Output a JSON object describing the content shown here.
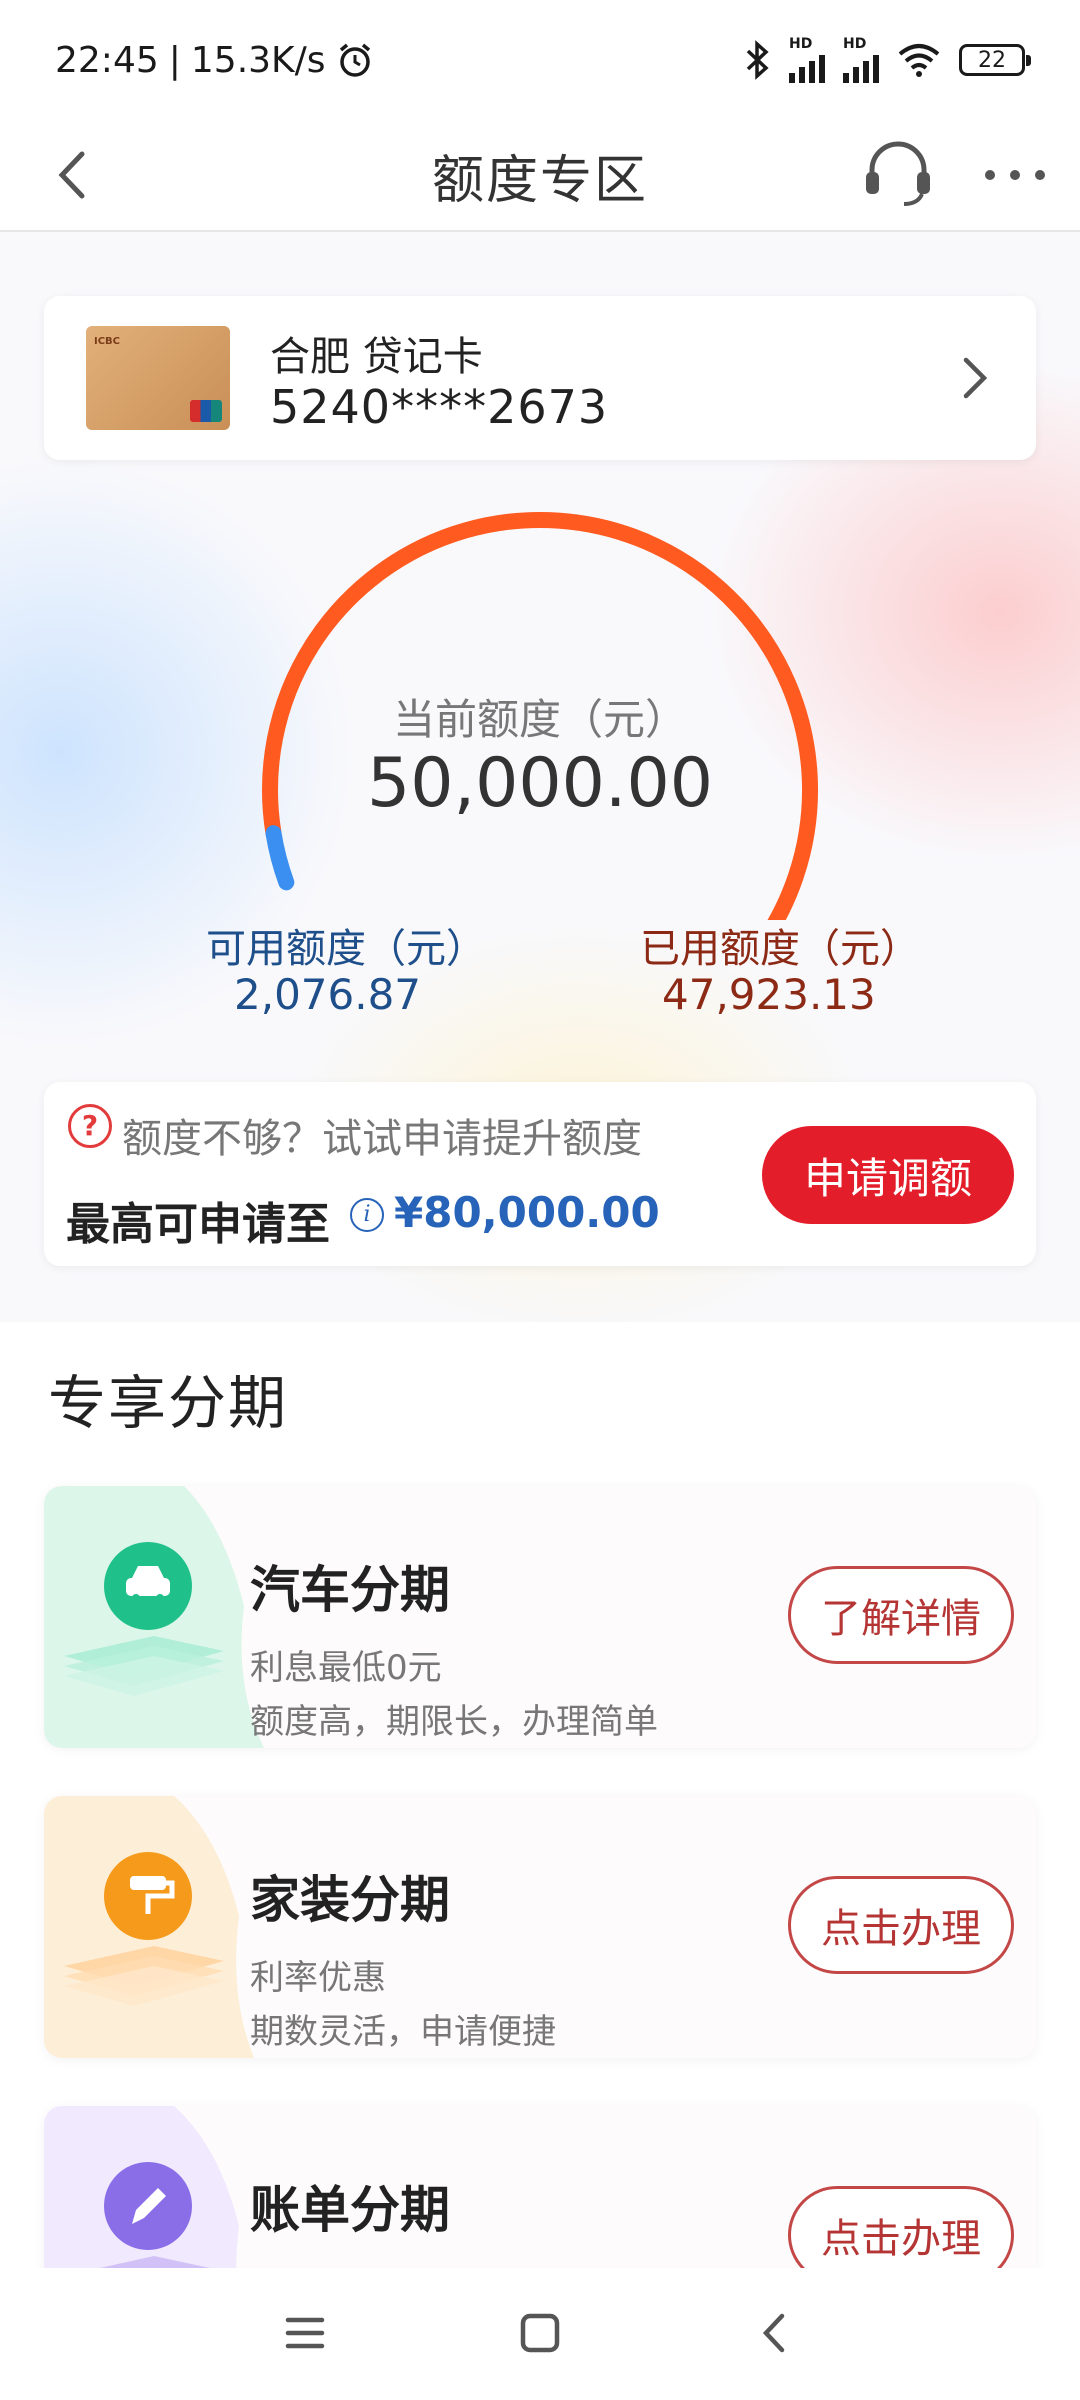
{
  "status_bar": {
    "time": "22:45",
    "speed": "15.3K/s",
    "battery": "22",
    "hd1": "HD",
    "hd2": "HD"
  },
  "header": {
    "title": "额度专区",
    "back_icon": "back-chevron-icon",
    "service_icon": "headset-icon",
    "more_icon": "more-dots-icon"
  },
  "card": {
    "name": "合肥 贷记卡",
    "number": "5240****2673"
  },
  "limit": {
    "current_label": "当前额度（元）",
    "current_value": "50,000.00",
    "available_label": "可用额度（元）",
    "available_value": "2,076.87",
    "used_label": "已用额度（元）",
    "used_value": "47,923.13",
    "available_fraction": 0.0415,
    "arc_used_color": "#ff5a1f",
    "arc_available_color": "#3b8ff0"
  },
  "raise": {
    "prompt": "额度不够？试试申请提升额度",
    "max_label": "最高可申请至",
    "max_amount": "¥80,000.00",
    "apply_label": "申请调额",
    "accent": "#e41d2a"
  },
  "section": {
    "title": "专享分期"
  },
  "installments": [
    {
      "title": "汽车分期",
      "sub1": "利息最低0元",
      "sub2": "额度高，期限长，办理简单",
      "button": "了解详情",
      "icon": "car-icon",
      "color": "#20c08a"
    },
    {
      "title": "家装分期",
      "sub1": "利率优惠",
      "sub2": "期数灵活，申请便捷",
      "button": "点击办理",
      "icon": "paint-roller-icon",
      "color": "#f59a1b"
    },
    {
      "title": "账单分期",
      "sub1": "",
      "sub2": "",
      "button": "点击办理",
      "icon": "pen-icon",
      "color": "#8a6ee8"
    }
  ],
  "nav": {
    "menu_icon": "menu-icon",
    "home_icon": "home-square-icon",
    "back_icon": "back-triangle-icon"
  }
}
